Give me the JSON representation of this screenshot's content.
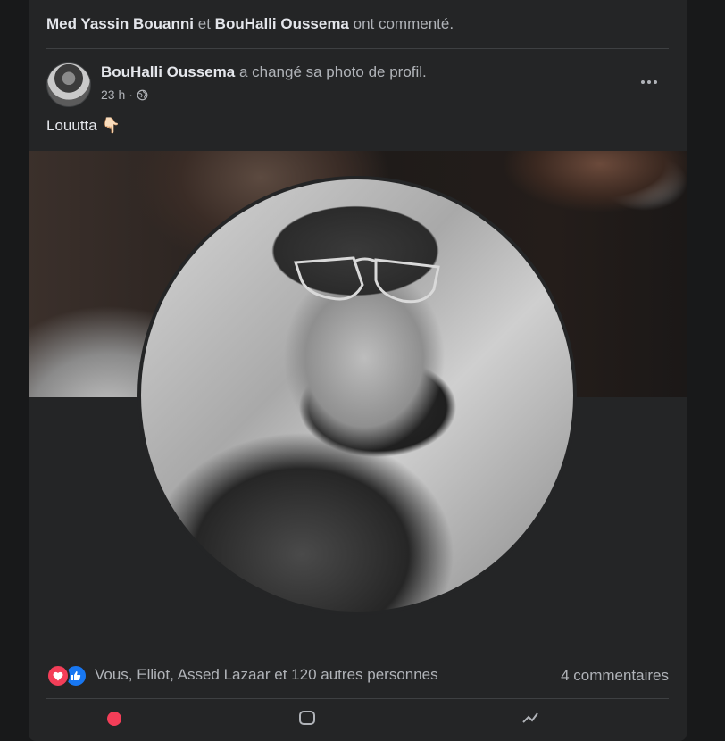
{
  "activity": {
    "actor1": "Med Yassin Bouanni",
    "connector": "et",
    "actor2": "BouHalli Oussema",
    "verb": "ont commenté."
  },
  "post": {
    "author": "BouHalli Oussema",
    "action": "a changé sa photo de profil.",
    "time": "23 h",
    "time_separator": "·",
    "privacy_icon": "globe-icon",
    "text": "Louutta 👇🏻",
    "more_icon": "more-options-icon"
  },
  "reactions": {
    "icons": [
      "heart-reaction-icon",
      "like-reaction-icon"
    ],
    "names": "Vous, Elliot, Assed Lazaar et 120 autres personnes",
    "comments": "4 commentaires"
  },
  "colors": {
    "background": "#18191a",
    "card": "#242526",
    "primary_text": "#e4e6eb",
    "secondary_text": "#b0b3b8",
    "heart": "#f33e58",
    "like": "#1877f2"
  }
}
